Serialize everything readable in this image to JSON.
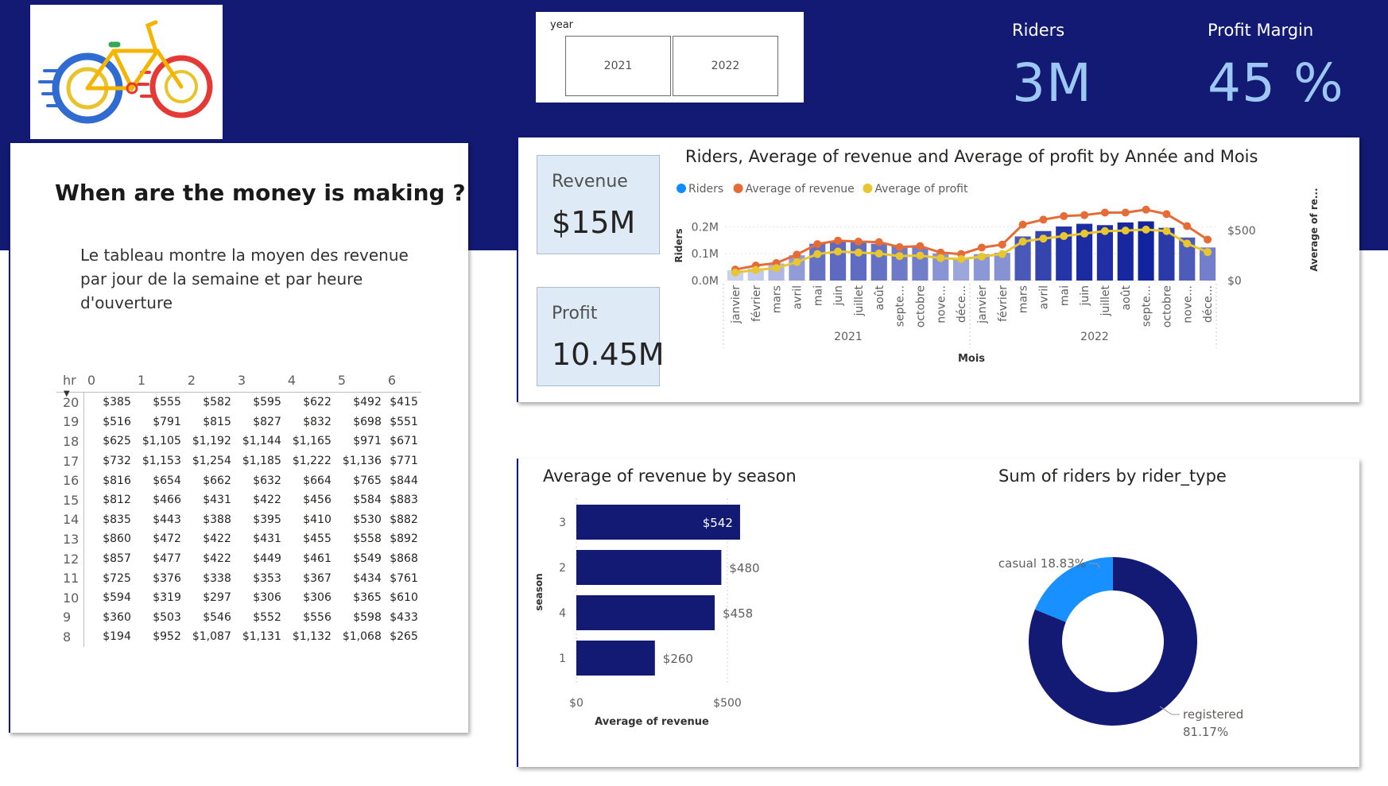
{
  "slicer": {
    "title": "year",
    "options": [
      "2021",
      "2022"
    ]
  },
  "kpis": [
    {
      "label": "Riders",
      "value": "3M"
    },
    {
      "label": "Profit Margin",
      "value": "45 %"
    }
  ],
  "left_panel": {
    "heading": "When are the money is making ?",
    "description": "Le tableau montre la moyen des revenue par jour de la semaine et par heure d'ouverture"
  },
  "matrix": {
    "row_header": "hr",
    "columns": [
      "0",
      "1",
      "2",
      "3",
      "4",
      "5",
      "6"
    ],
    "rows": [
      {
        "hr": "20",
        "values": [
          "$385",
          "$555",
          "$582",
          "$595",
          "$622",
          "$492",
          "$415"
        ]
      },
      {
        "hr": "19",
        "values": [
          "$516",
          "$791",
          "$815",
          "$827",
          "$832",
          "$698",
          "$551"
        ]
      },
      {
        "hr": "18",
        "values": [
          "$625",
          "$1,105",
          "$1,192",
          "$1,144",
          "$1,165",
          "$971",
          "$671"
        ]
      },
      {
        "hr": "17",
        "values": [
          "$732",
          "$1,153",
          "$1,254",
          "$1,185",
          "$1,222",
          "$1,136",
          "$771"
        ]
      },
      {
        "hr": "16",
        "values": [
          "$816",
          "$654",
          "$662",
          "$632",
          "$664",
          "$765",
          "$844"
        ]
      },
      {
        "hr": "15",
        "values": [
          "$812",
          "$466",
          "$431",
          "$422",
          "$456",
          "$584",
          "$883"
        ]
      },
      {
        "hr": "14",
        "values": [
          "$835",
          "$443",
          "$388",
          "$395",
          "$410",
          "$530",
          "$882"
        ]
      },
      {
        "hr": "13",
        "values": [
          "$860",
          "$472",
          "$422",
          "$431",
          "$455",
          "$558",
          "$892"
        ]
      },
      {
        "hr": "12",
        "values": [
          "$857",
          "$477",
          "$422",
          "$449",
          "$461",
          "$549",
          "$868"
        ]
      },
      {
        "hr": "11",
        "values": [
          "$725",
          "$376",
          "$338",
          "$353",
          "$367",
          "$434",
          "$761"
        ]
      },
      {
        "hr": "10",
        "values": [
          "$594",
          "$319",
          "$297",
          "$306",
          "$306",
          "$365",
          "$610"
        ]
      },
      {
        "hr": "9",
        "values": [
          "$360",
          "$503",
          "$546",
          "$552",
          "$556",
          "$598",
          "$433"
        ]
      },
      {
        "hr": "8",
        "values": [
          "$194",
          "$952",
          "$1,087",
          "$1,131",
          "$1,132",
          "$1,068",
          "$265"
        ]
      }
    ]
  },
  "tiles": [
    {
      "label": "Revenue",
      "value": "$15M"
    },
    {
      "label": "Profit",
      "value": "10.45M"
    }
  ],
  "colors": {
    "banner": "#121a73",
    "kpi_value": "#9cc8f3",
    "riders_legend": "#118dff",
    "revenue_line": "#e66c37",
    "profit_line": "#e8c62f",
    "bar_dark": "#12239e",
    "donut_registered": "#121a73",
    "donut_casual": "#1890ff"
  },
  "chart_data": [
    {
      "type": "bar+line",
      "title": "Riders, Average of revenue and Average of profit by Année and Mois",
      "legend": [
        "Riders",
        "Average of revenue",
        "Average of profit"
      ],
      "xlabel": "Mois",
      "ylabel_left": "Riders",
      "ylabel_right": "Average of re...",
      "year_groups": [
        "2021",
        "2022"
      ],
      "categories": [
        "janvier",
        "février",
        "mars",
        "avril",
        "mai",
        "juin",
        "juillet",
        "août",
        "septe...",
        "octobre",
        "nove...",
        "déce...",
        "janvier",
        "février",
        "mars",
        "avril",
        "mai",
        "juin",
        "juillet",
        "août",
        "septe...",
        "octobre",
        "nove...",
        "déce..."
      ],
      "y_ticks_left": [
        "0.0M",
        "0.1M",
        "0.2M"
      ],
      "y_ticks_right": [
        "$0",
        "$500"
      ],
      "ylim_left": [
        0,
        0.26
      ],
      "ylim_right": [
        0,
        700
      ],
      "legend_position": "top-left",
      "series": [
        {
          "name": "Riders",
          "axis": "left",
          "values": [
            0.038,
            0.045,
            0.064,
            0.094,
            0.137,
            0.145,
            0.143,
            0.137,
            0.128,
            0.124,
            0.101,
            0.082,
            0.098,
            0.103,
            0.164,
            0.184,
            0.201,
            0.211,
            0.206,
            0.216,
            0.22,
            0.196,
            0.16,
            0.123
          ]
        },
        {
          "name": "Average of revenue",
          "axis": "right",
          "values": [
            110,
            150,
            175,
            260,
            365,
            400,
            390,
            385,
            335,
            345,
            280,
            265,
            330,
            360,
            560,
            610,
            645,
            655,
            680,
            680,
            710,
            665,
            545,
            410
          ]
        },
        {
          "name": "Average of profit",
          "axis": "right",
          "values": [
            80,
            105,
            125,
            185,
            265,
            290,
            280,
            270,
            245,
            250,
            225,
            215,
            240,
            265,
            390,
            420,
            445,
            470,
            495,
            500,
            510,
            495,
            370,
            285
          ]
        }
      ]
    },
    {
      "type": "bar",
      "orientation": "horizontal",
      "title": "Average of revenue by season",
      "xlabel": "Average of revenue",
      "ylabel": "season",
      "categories": [
        "3",
        "2",
        "4",
        "1"
      ],
      "values": [
        542,
        480,
        458,
        260
      ],
      "data_labels": [
        "$542",
        "$480",
        "$458",
        "$260"
      ],
      "x_ticks": [
        "$0",
        "$500"
      ],
      "xlim": [
        0,
        500
      ]
    },
    {
      "type": "pie",
      "title": "Sum of riders by rider_type",
      "categories": [
        "casual",
        "registered"
      ],
      "values": [
        18.83,
        81.17
      ],
      "data_labels": [
        "18.83%",
        "81.17%"
      ]
    }
  ]
}
